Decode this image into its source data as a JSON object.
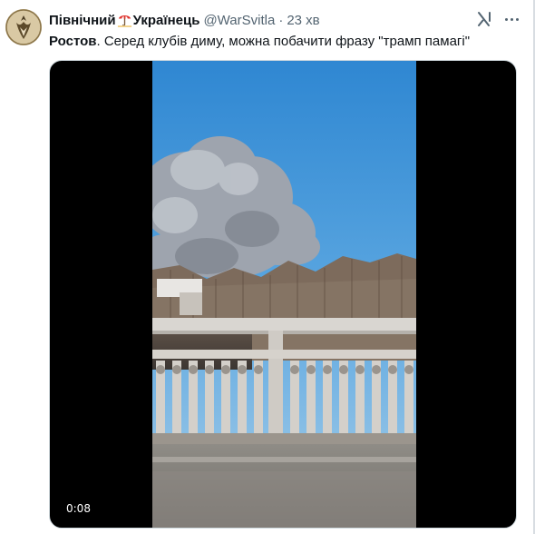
{
  "author": {
    "name_part1": "Північний",
    "name_part2": "Українець",
    "handle": "@WarSvitla",
    "separator": "·",
    "time": "23 хв"
  },
  "tweet": {
    "location": "Ростов",
    "text": ". Серед клубів диму, можна побачити фразу \"трамп памагі\""
  },
  "media": {
    "duration": "0:08"
  },
  "icons": {
    "flag": "beach-umbrella-emoji",
    "grok": "grok-icon",
    "more": "more-icon"
  },
  "colors": {
    "text_primary": "#0f1419",
    "text_secondary": "#536471",
    "sky": "#3f8fd3",
    "smoke": "#a7acb5"
  }
}
